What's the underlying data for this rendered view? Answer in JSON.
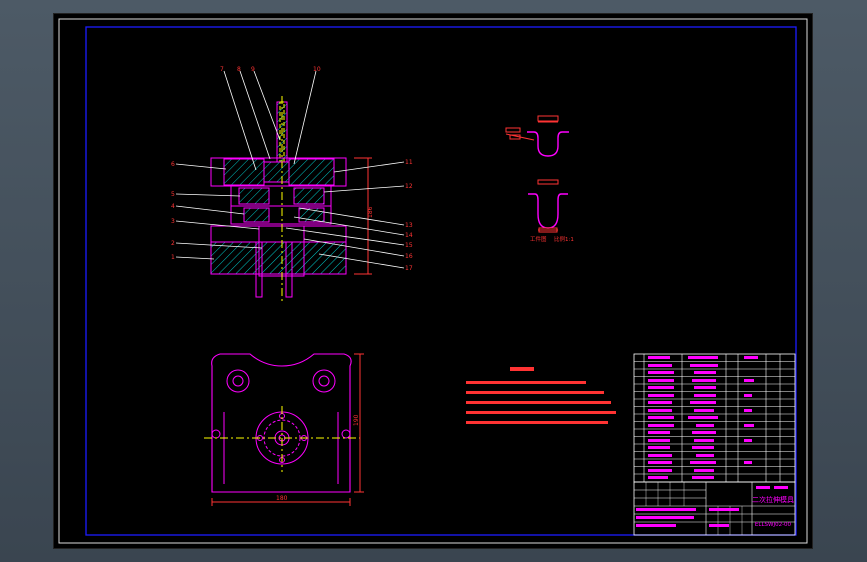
{
  "title_block": {
    "drawing_title": "二次拉伸模具",
    "drawing_number": "ELLSWJ02-00"
  },
  "annotations": {
    "part_labels_top": [
      "7",
      "8",
      "9",
      "10"
    ],
    "part_labels_left": [
      "6",
      "5",
      "4",
      "3",
      "2",
      "1"
    ],
    "part_labels_right": [
      "11",
      "12",
      "13",
      "14",
      "15",
      "16",
      "17"
    ],
    "overall_height_dim": "186",
    "plan_width_dim": "180",
    "plan_height_dim": "190",
    "workpiece_label": "工件图",
    "scale_label": "比例1:1"
  },
  "colors": {
    "sheet_bg": "#000000",
    "frame": "#1c1cff",
    "outline": "#ff00ff",
    "hatch": "#00c8c8",
    "centerline": "#ffff00",
    "leader": "#ffffff",
    "dimension": "#ff3333",
    "table_text": "#ff00ff"
  }
}
